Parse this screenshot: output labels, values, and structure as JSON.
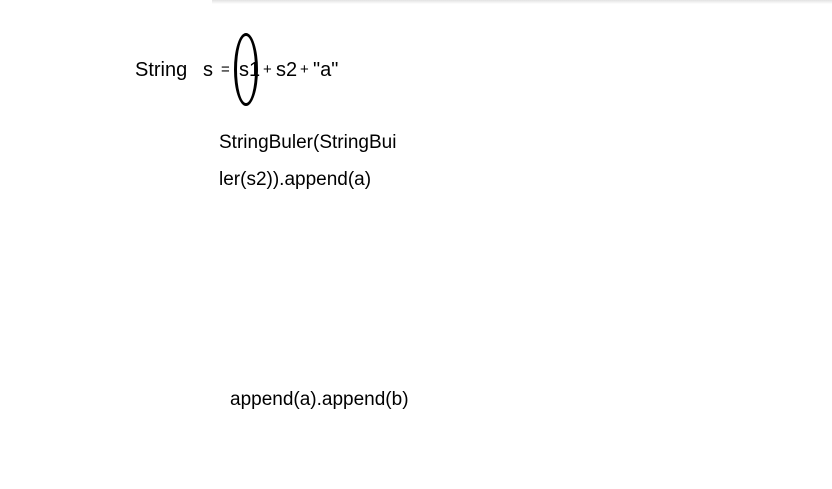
{
  "expression": {
    "type_keyword": "String",
    "variable": "s",
    "equals": "=",
    "operand_1": "s1",
    "plus_1": "+",
    "operand_2": "s2",
    "plus_2": "+",
    "operand_3": "\"a\""
  },
  "annotation_1": {
    "line_1": "StringBuler(StringBui",
    "line_2": "ler(s2)).append(a)"
  },
  "annotation_2": {
    "text": "append(a).append(b)"
  }
}
